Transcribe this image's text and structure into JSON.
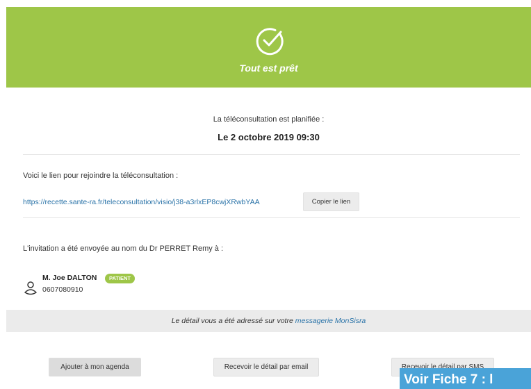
{
  "header": {
    "title": "Tout est prêt",
    "icon": "check-circle-icon",
    "background_color": "#9ec648"
  },
  "schedule": {
    "label": "La téléconsultation est planifiée :",
    "date": "Le 2 octobre 2019 09:30"
  },
  "link_section": {
    "label": "Voici le lien pour rejoindre la téléconsultation :",
    "url": "https://recette.sante-ra.fr/teleconsultation/visio/j38-a3rlxEP8cwjXRwbYAA",
    "copy_button": "Copier le lien"
  },
  "invitation": {
    "label": "L'invitation a été envoyée au nom du Dr PERRET Remy à :",
    "patient": {
      "name": "M. Joe DALTON",
      "badge": "PATIENT",
      "phone": "0607080910",
      "icon": "user-icon"
    }
  },
  "info_bar": {
    "text": "Le détail vous a été adressé sur votre ",
    "link": "messagerie MonSisra"
  },
  "actions": {
    "agenda": "Ajouter à mon agenda",
    "email": "Recevoir le détail par email",
    "sms": "Recevoir le détail par SMS"
  },
  "overlay": {
    "text": "Voir Fiche 7 : l"
  },
  "colors": {
    "accent_green": "#9ec648",
    "link_blue": "#2a73a8",
    "overlay_blue": "#4aa3d8"
  }
}
